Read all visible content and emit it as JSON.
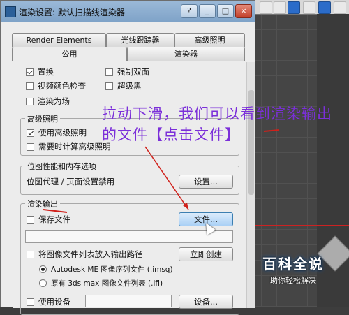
{
  "dialog": {
    "title": "渲染设置: 默认扫描线渲染器",
    "window_buttons": [
      "?",
      "_",
      "□",
      "×"
    ]
  },
  "tabs": {
    "row1": [
      "Render Elements",
      "光线跟踪器",
      "高级照明"
    ],
    "row2": [
      "公用",
      "渲染器"
    ]
  },
  "top_partial": {
    "item1": "置换",
    "item2": "强制双面",
    "video_check": "视频颜色检查",
    "superblack": "超级黑",
    "render_fields": "渲染为场"
  },
  "advanced_lighting": {
    "title": "高级照明",
    "use": "使用高级照明",
    "compute": "需要时计算高级照明"
  },
  "bitmap_perf": {
    "title": "位图性能和内存选项",
    "proxy_text": "位图代理 / 页面设置禁用",
    "setup_button": "设置..."
  },
  "render_output": {
    "title": "渲染输出",
    "save_file": "保存文件",
    "files_button": "文件...",
    "file_path": "",
    "put_image_list": "将图像文件列表放入输出路径",
    "create_now_button": "立即创建",
    "radio_imsq": "Autodesk ME 图像序列文件 (.imsq)",
    "radio_ifl": "原有 3ds max 图像文件列表 (.ifl)",
    "use_device": "使用设备",
    "devices_button": "设备..."
  },
  "annotation": {
    "text": "拉动下滑，我们可以看到渲染输出的文件【点击文件】"
  },
  "watermark": {
    "main": "百科全说",
    "sub": "助你轻松解决"
  }
}
